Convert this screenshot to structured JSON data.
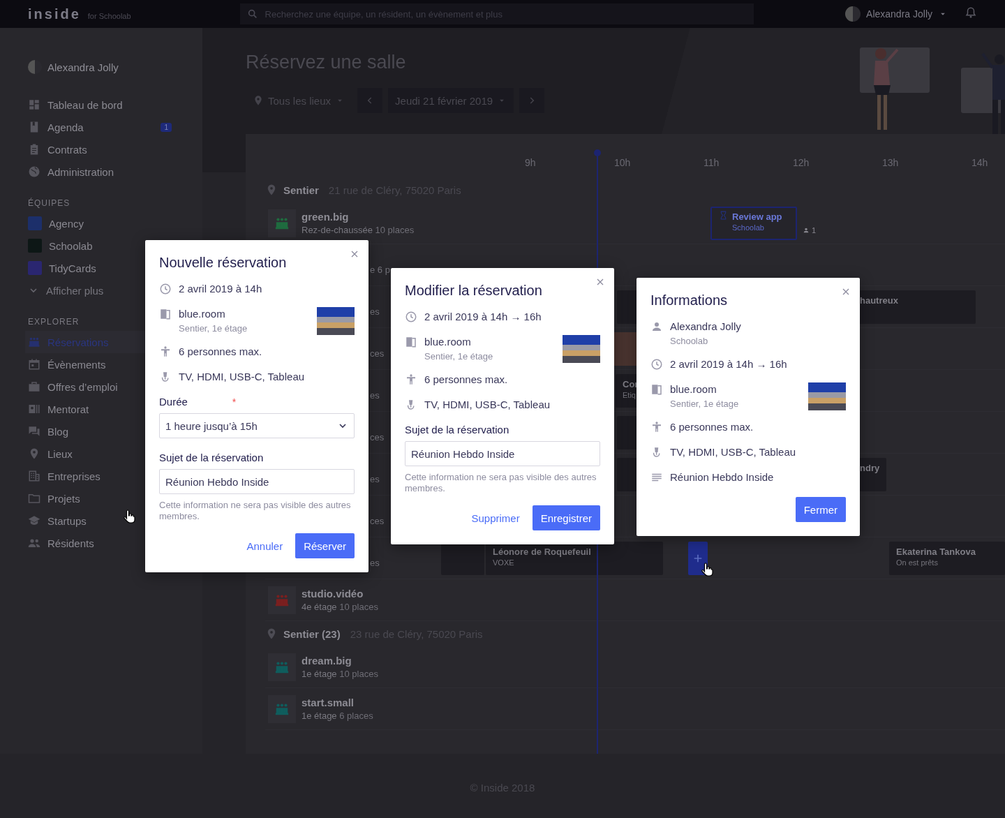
{
  "topbar": {
    "logo": "inside",
    "logo_suffix": "for Schoolab",
    "search": {
      "placeholder": "Recherchez une équipe, un résident, un évènement et plus"
    },
    "user": "Alexandra Jolly"
  },
  "sidebar": {
    "user": "Alexandra Jolly",
    "nav": [
      {
        "label": "Tableau de bord",
        "selected": false
      },
      {
        "label": "Agenda",
        "badge": "1",
        "selected": false
      },
      {
        "label": "Contrats",
        "selected": false
      },
      {
        "label": "Administration",
        "selected": false
      }
    ],
    "sections": [
      {
        "title": "ÉQUIPES",
        "items": [
          {
            "kind": "team",
            "label": "Agency",
            "color": "#1c2f6a",
            "selected": false
          },
          {
            "kind": "team",
            "label": "Schoolab",
            "color": "#0d1716",
            "selected": false
          },
          {
            "kind": "team",
            "label": "TidyCards",
            "color": "#2a2670",
            "selected": false
          },
          {
            "kind": "more",
            "label": "Afficher plus",
            "selected": false
          }
        ]
      },
      {
        "title": "EXPLORER",
        "items": [
          {
            "kind": "nav",
            "label": "Réservations",
            "selected": true
          },
          {
            "kind": "nav",
            "label": "Évènements",
            "selected": false
          },
          {
            "kind": "nav",
            "label": "Offres d’emploi",
            "selected": false
          },
          {
            "kind": "nav",
            "label": "Mentorat",
            "selected": false
          },
          {
            "kind": "nav",
            "label": "Blog",
            "selected": false
          },
          {
            "kind": "nav",
            "label": "Lieux",
            "selected": false
          },
          {
            "kind": "nav",
            "label": "Entreprises",
            "selected": false
          },
          {
            "kind": "nav",
            "label": "Projets",
            "selected": false
          },
          {
            "kind": "nav",
            "label": "Startups",
            "selected": false
          },
          {
            "kind": "nav",
            "label": "Résidents",
            "selected": false
          }
        ]
      }
    ]
  },
  "header": {
    "title": "Réservez une salle",
    "location_filter": "Tous les lieux",
    "date": "Jeudi 21 février 2019"
  },
  "timeline": {
    "hours": [
      "9h",
      "10h",
      "11h",
      "12h",
      "13h",
      "14h"
    ],
    "locations": [
      {
        "name": "Sentier",
        "address": "21 rue de Cléry, 75020 Paris",
        "rooms": [
          {
            "name": "green.big",
            "floor": "Rez-de-chaussée",
            "capacity": "10 places",
            "color": "#1f6b3f",
            "events": [
              {
                "kind": "pending",
                "title": "Review app",
                "subtitle": "Schoolab",
                "attendees": "1"
              }
            ]
          },
          {
            "label_tail": "e 6 p"
          },
          {
            "label_tail": "es",
            "events": [
              {
                "kind": "booking"
              },
              {
                "kind": "booking",
                "title": "hautreux"
              }
            ]
          },
          {
            "label_tail": "ces",
            "events": [
              {
                "kind": "highlight"
              }
            ]
          },
          {
            "label_tail": "es",
            "events": [
              {
                "kind": "booking",
                "title": "Cor",
                "subtitle": "Etiq"
              }
            ]
          },
          {
            "label_tail": "ces",
            "events": [
              {
                "kind": "booking"
              }
            ]
          },
          {
            "label_tail": "es",
            "events": [
              {
                "kind": "booking"
              },
              {
                "kind": "booking",
                "title": "ndry"
              }
            ]
          },
          {
            "label_tail": "ces"
          },
          {
            "label_tail": "es",
            "events": [
              {
                "kind": "booking"
              },
              {
                "kind": "booking",
                "title": "Léonore de Roquefeuil",
                "subtitle": "VOXE"
              },
              {
                "kind": "add"
              },
              {
                "kind": "booking",
                "title": "Ekaterina Tankova",
                "subtitle": "On est prêts"
              }
            ]
          },
          {
            "name": "studio.vidéo",
            "floor": "4e étage",
            "capacity": "10 places",
            "color": "#7a1f1f"
          }
        ]
      },
      {
        "name": "Sentier (23)",
        "address": "23 rue de Cléry, 75020 Paris",
        "rooms": [
          {
            "name": "dream.big",
            "floor": "1e étage",
            "capacity": "10 places",
            "color": "#0f5d5d"
          },
          {
            "name": "start.small",
            "floor": "1e étage",
            "capacity": "6 places",
            "color": "#0f5d5d"
          }
        ]
      }
    ]
  },
  "dialogs": [
    {
      "title": "Nouvelle réservation",
      "details": [
        {
          "kind": "time",
          "text": "2 avril 2019 à 14h"
        },
        {
          "kind": "room",
          "text": "blue.room",
          "subtext": "Sentier, 1e étage"
        },
        {
          "kind": "capacity",
          "text": "6 personnes max."
        },
        {
          "kind": "equipment",
          "text": "TV, HDMI, USB-C, Tableau"
        }
      ],
      "fields": [
        {
          "kind": "select",
          "label": "Durée",
          "required_mark": "*",
          "value": "1 heure jusqu’à 15h"
        },
        {
          "kind": "text",
          "label": "Sujet de la réservation",
          "value": "Réunion Hebdo Inside",
          "hint": "Cette information ne sera pas visible des autres membres."
        }
      ],
      "buttons": [
        {
          "kind": "link",
          "label": "Annuler"
        },
        {
          "kind": "primary",
          "label": "Réserver"
        }
      ]
    },
    {
      "title": "Modifier la réservation",
      "details": [
        {
          "kind": "time",
          "text": "2 avril 2019 à 14h → 16h"
        },
        {
          "kind": "room",
          "text": "blue.room",
          "subtext": "Sentier, 1e étage"
        },
        {
          "kind": "capacity",
          "text": "6 personnes max."
        },
        {
          "kind": "equipment",
          "text": "TV, HDMI, USB-C, Tableau"
        }
      ],
      "fields": [
        {
          "kind": "text",
          "label": "Sujet de la réservation",
          "value": "Réunion Hebdo Inside",
          "hint": "Cette information ne sera pas visible des autres membres."
        }
      ],
      "buttons": [
        {
          "kind": "link",
          "label": "Supprimer"
        },
        {
          "kind": "primary",
          "label": "Enregistrer"
        }
      ]
    },
    {
      "title": "Informations",
      "details": [
        {
          "kind": "user",
          "text": "Alexandra Jolly",
          "subtext": "Schoolab"
        },
        {
          "kind": "time",
          "text": "2 avril 2019 à 14h → 16h"
        },
        {
          "kind": "room",
          "text": "blue.room",
          "subtext": "Sentier, 1e étage"
        },
        {
          "kind": "capacity",
          "text": "6 personnes max."
        },
        {
          "kind": "equipment",
          "text": "TV, HDMI, USB-C, Tableau"
        },
        {
          "kind": "note",
          "text": "Réunion Hebdo Inside"
        }
      ],
      "buttons": [
        {
          "kind": "primary",
          "label": "Fermer"
        }
      ]
    }
  ],
  "footer": "© Inside 2018"
}
